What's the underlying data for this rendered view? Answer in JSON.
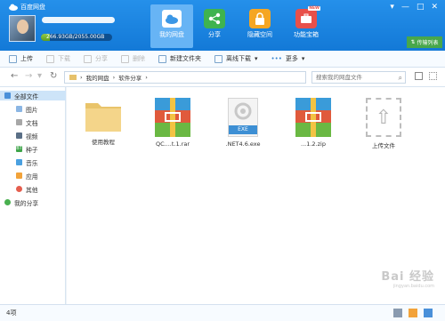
{
  "window": {
    "title": "百度网盘",
    "minimize": "—",
    "maximize": "□",
    "close": "✕"
  },
  "user": {
    "quota_text": "266.93GB/2055.00GB",
    "quota_fraction": 0.13
  },
  "nav_tabs": [
    {
      "label": "我的网盘",
      "icon": "cloud-icon",
      "color": "#ffffff"
    },
    {
      "label": "分享",
      "icon": "share-icon",
      "color": "#3fb34f"
    },
    {
      "label": "隐藏空间",
      "icon": "lock-icon",
      "color": "#f5a623"
    },
    {
      "label": "功能宝箱",
      "icon": "toolbox-icon",
      "color": "#e8504a",
      "badge": "NEW"
    }
  ],
  "transfer_button": {
    "label": "传输列表"
  },
  "toolbar": {
    "upload": "上传",
    "download": "下载",
    "share": "分享",
    "delete": "删除",
    "new_folder": "新建文件夹",
    "offline": "离线下载",
    "more": "更多"
  },
  "address": {
    "crumbs": [
      "我的网盘",
      "软件分享"
    ],
    "search_placeholder": "搜索我的网盘文件"
  },
  "sidebar": {
    "all_files": "全部文件",
    "categories": [
      "图片",
      "文档",
      "视频",
      "种子",
      "音乐",
      "应用",
      "其他"
    ],
    "my_share": "我的分享"
  },
  "files": [
    {
      "name": "使用教程",
      "type": "folder"
    },
    {
      "name": "QC....t.1.rar",
      "type": "rar"
    },
    {
      "name": ".NET4.6.exe",
      "type": "exe",
      "badge": "EXE"
    },
    {
      "name": "...1.2.zip",
      "type": "zip"
    },
    {
      "name": "上传文件",
      "type": "upload"
    }
  ],
  "status": {
    "count": "4项"
  },
  "watermark": {
    "text": "Bai 经验",
    "sub": "jingyan.baidu.com"
  }
}
